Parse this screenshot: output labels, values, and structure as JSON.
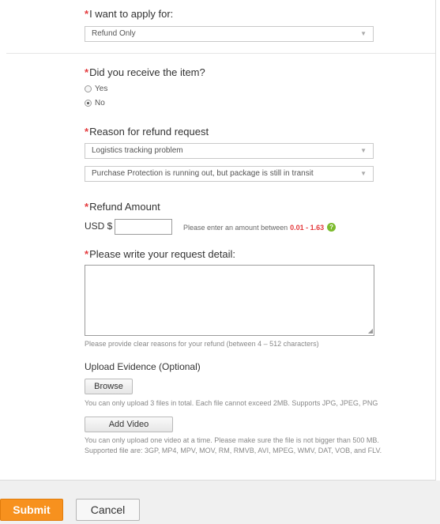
{
  "apply_for": {
    "required_mark": "*",
    "label": "I want to apply for:",
    "selected": "Refund Only"
  },
  "received_item": {
    "required_mark": "*",
    "label": "Did you receive the item?",
    "options": [
      {
        "label": "Yes",
        "checked": false
      },
      {
        "label": "No",
        "checked": true
      }
    ]
  },
  "reason": {
    "required_mark": "*",
    "label": "Reason for refund request",
    "primary_selected": "Logistics tracking problem",
    "secondary_selected": "Purchase Protection is running out, but package is still in transit"
  },
  "refund_amount": {
    "required_mark": "*",
    "label": "Refund Amount",
    "currency": "USD $",
    "value": "",
    "hint_prefix": "Please enter an amount between",
    "range": "0.01 - 1.63",
    "help_icon": "?"
  },
  "request_detail": {
    "required_mark": "*",
    "label": "Please write your request detail:",
    "value": "",
    "note": "Please provide clear reasons for your refund (between 4 – 512 characters)"
  },
  "evidence": {
    "label": "Upload Evidence (Optional)",
    "browse_label": "Browse",
    "browse_note": "You can only upload 3 files in total. Each file cannot exceed 2MB. Supports JPG, JPEG, PNG",
    "add_video_label": "Add Video",
    "video_note": "You can only upload one video at a time. Please make sure the file is not bigger than 500 MB. Supported file are: 3GP, MP4, MPV, MOV, RM, RMVB, AVI, MPEG, WMV, DAT, VOB, and FLV."
  },
  "actions": {
    "submit_label": "Submit",
    "cancel_label": "Cancel"
  },
  "colors": {
    "required": "#e4393c",
    "submit": "#f7911e",
    "help_icon": "#7cbb2d"
  }
}
